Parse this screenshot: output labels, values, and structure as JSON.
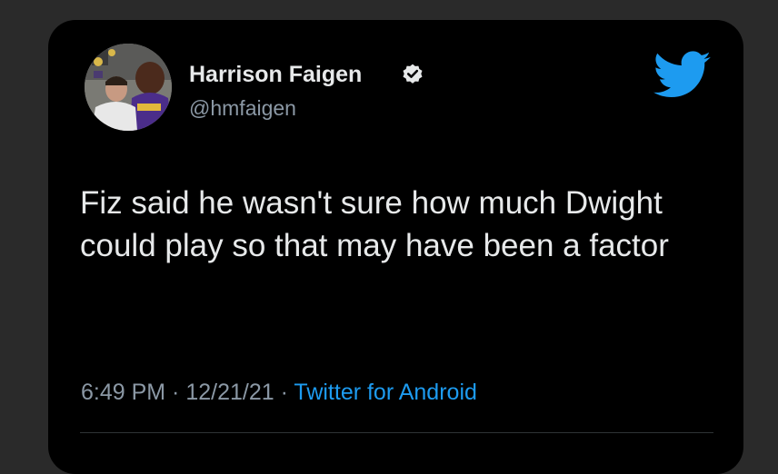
{
  "tweet": {
    "author": {
      "display_name": "Harrison Faigen",
      "handle": "@hmfaigen",
      "verified": true
    },
    "text": "Fiz said he wasn't sure how much Dwight could play so that may have been a factor",
    "time": "6:49 PM",
    "separator": " · ",
    "date": "12/21/21",
    "source": "Twitter for Android"
  },
  "icons": {
    "logo": "twitter-bird-icon",
    "verified": "verified-badge-icon"
  },
  "colors": {
    "background": "#000000",
    "page": "#2a2a2a",
    "text": "#e7e9ea",
    "muted": "#8b98a5",
    "accent": "#1d9bf0"
  }
}
